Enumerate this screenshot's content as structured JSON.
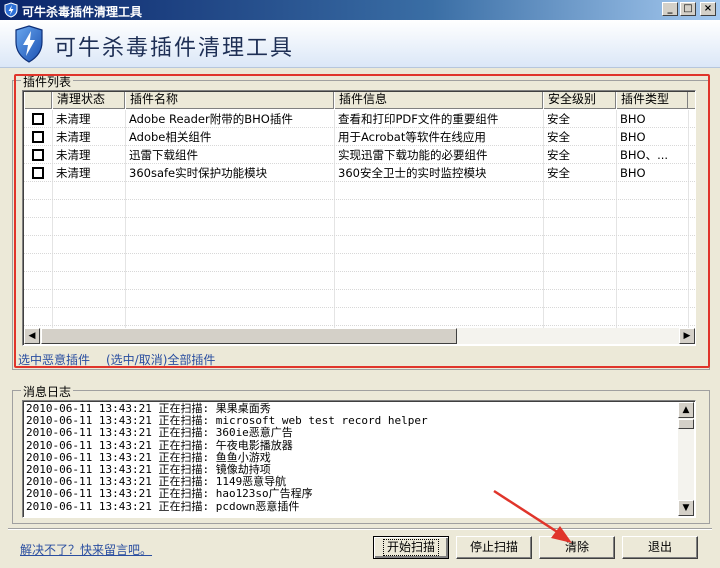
{
  "window": {
    "title": "可牛杀毒插件清理工具",
    "controls": [
      "_",
      "□",
      "×"
    ]
  },
  "header": {
    "title": "可牛杀毒插件清理工具"
  },
  "plugin_list": {
    "group_title": "插件列表",
    "columns": [
      "",
      "清理状态",
      "插件名称",
      "插件信息",
      "安全级别",
      "插件类型"
    ],
    "rows": [
      {
        "status": "未清理",
        "name": "Adobe Reader附带的BHO插件",
        "info": "查看和打印PDF文件的重要组件",
        "level": "安全",
        "type": "BHO"
      },
      {
        "status": "未清理",
        "name": "Adobe相关组件",
        "info": "用于Acrobat等软件在线应用",
        "level": "安全",
        "type": "BHO"
      },
      {
        "status": "未清理",
        "name": "迅雷下载组件",
        "info": "实现迅雷下载功能的必要组件",
        "level": "安全",
        "type": "BHO、..."
      },
      {
        "status": "未清理",
        "name": "360safe实时保护功能模块",
        "info": "360安全卫士的实时监控模块",
        "level": "安全",
        "type": "BHO"
      }
    ],
    "select_malicious_link": "选中恶意插件",
    "toggle_all_link": "(选中/取消)全部插件"
  },
  "log": {
    "group_title": "消息日志",
    "lines": [
      "2010-06-11 13:43:21 正在扫描: 果果桌面秀",
      "2010-06-11 13:43:21 正在扫描: microsoft web test record helper",
      "2010-06-11 13:43:21 正在扫描: 360ie恶意广告",
      "2010-06-11 13:43:21 正在扫描: 午夜电影播放器",
      "2010-06-11 13:43:21 正在扫描: 鱼鱼小游戏",
      "2010-06-11 13:43:21 正在扫描: 镜像劫持项",
      "2010-06-11 13:43:21 正在扫描: 1149恶意导航",
      "2010-06-11 13:43:21 正在扫描: hao123so广告程序",
      "2010-06-11 13:43:21 正在扫描: pcdown恶意插件"
    ]
  },
  "footer": {
    "help_link": "解决不了？快来留言吧。",
    "start_scan": "开始扫描",
    "stop_scan": "停止扫描",
    "clean": "清除",
    "exit": "退出"
  },
  "colors": {
    "highlight_red": "#e0352b",
    "title_bar": "#0a246a",
    "link": "#2a4ea0"
  }
}
